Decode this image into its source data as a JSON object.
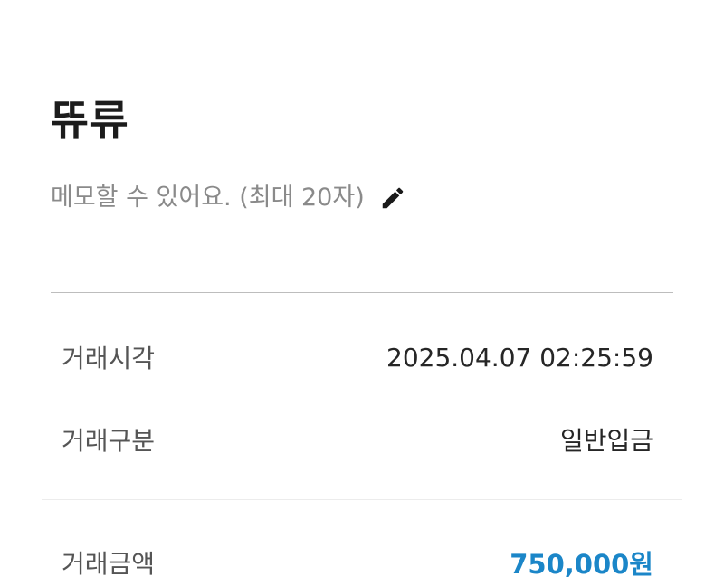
{
  "header": {
    "title": "뜌류"
  },
  "memo": {
    "placeholder_text": "메모할 수 있어요. (최대 20자)",
    "edit_icon": "pencil-icon"
  },
  "details": [
    {
      "label": "거래시각",
      "value": "2025.04.07 02:25:59"
    },
    {
      "label": "거래구분",
      "value": "일반입금"
    }
  ],
  "amount": {
    "label": "거래금액",
    "value": "750,000원",
    "color": "#1b86c8"
  }
}
